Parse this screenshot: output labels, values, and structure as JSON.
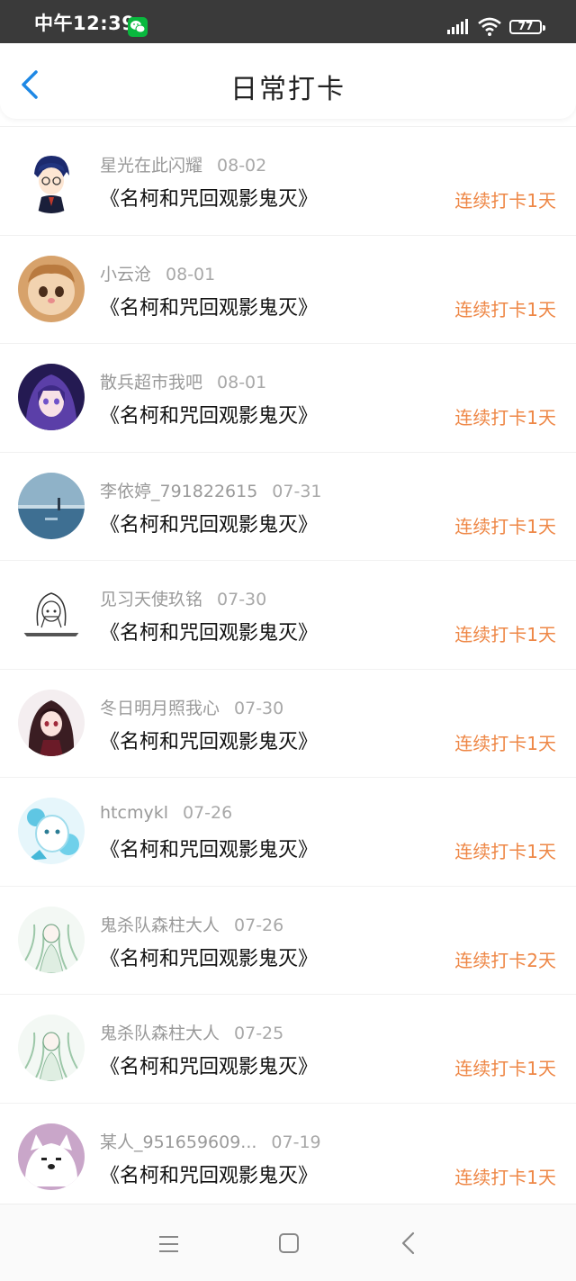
{
  "status_bar": {
    "time": "中午12:39",
    "battery": "77",
    "icons": [
      "wechat-icon",
      "signal-icon",
      "wifi-icon",
      "battery-icon"
    ]
  },
  "header": {
    "title": "日常打卡",
    "back_icon": "chevron-left-icon"
  },
  "colors": {
    "accent_blue": "#1e88e5",
    "streak_orange": "#ee8746",
    "status_bar_bg": "#3a3a3a"
  },
  "checkins": [
    {
      "user": "星光在此闪耀",
      "date": "08-02",
      "book": "《名柯和咒回观影鬼灭》",
      "streak": "连续打卡1天"
    },
    {
      "user": "小云沧",
      "date": "08-01",
      "book": "《名柯和咒回观影鬼灭》",
      "streak": "连续打卡1天"
    },
    {
      "user": "散兵超市我吧",
      "date": "08-01",
      "book": "《名柯和咒回观影鬼灭》",
      "streak": "连续打卡1天"
    },
    {
      "user": "李依婷_791822615",
      "date": "07-31",
      "book": "《名柯和咒回观影鬼灭》",
      "streak": "连续打卡1天"
    },
    {
      "user": "见习天使玖铭",
      "date": "07-30",
      "book": "《名柯和咒回观影鬼灭》",
      "streak": "连续打卡1天"
    },
    {
      "user": "冬日明月照我心",
      "date": "07-30",
      "book": "《名柯和咒回观影鬼灭》",
      "streak": "连续打卡1天"
    },
    {
      "user": "htcmykl",
      "date": "07-26",
      "book": "《名柯和咒回观影鬼灭》",
      "streak": "连续打卡1天"
    },
    {
      "user": "鬼杀队森柱大人",
      "date": "07-26",
      "book": "《名柯和咒回观影鬼灭》",
      "streak": "连续打卡2天"
    },
    {
      "user": "鬼杀队森柱大人",
      "date": "07-25",
      "book": "《名柯和咒回观影鬼灭》",
      "streak": "连续打卡1天"
    },
    {
      "user": "某人_951659609...",
      "date": "07-19",
      "book": "《名柯和咒回观影鬼灭》",
      "streak": "连续打卡1天"
    }
  ],
  "nav_bar": {
    "icons": [
      "menu-icon",
      "home-square-icon",
      "back-triangle-icon"
    ]
  }
}
